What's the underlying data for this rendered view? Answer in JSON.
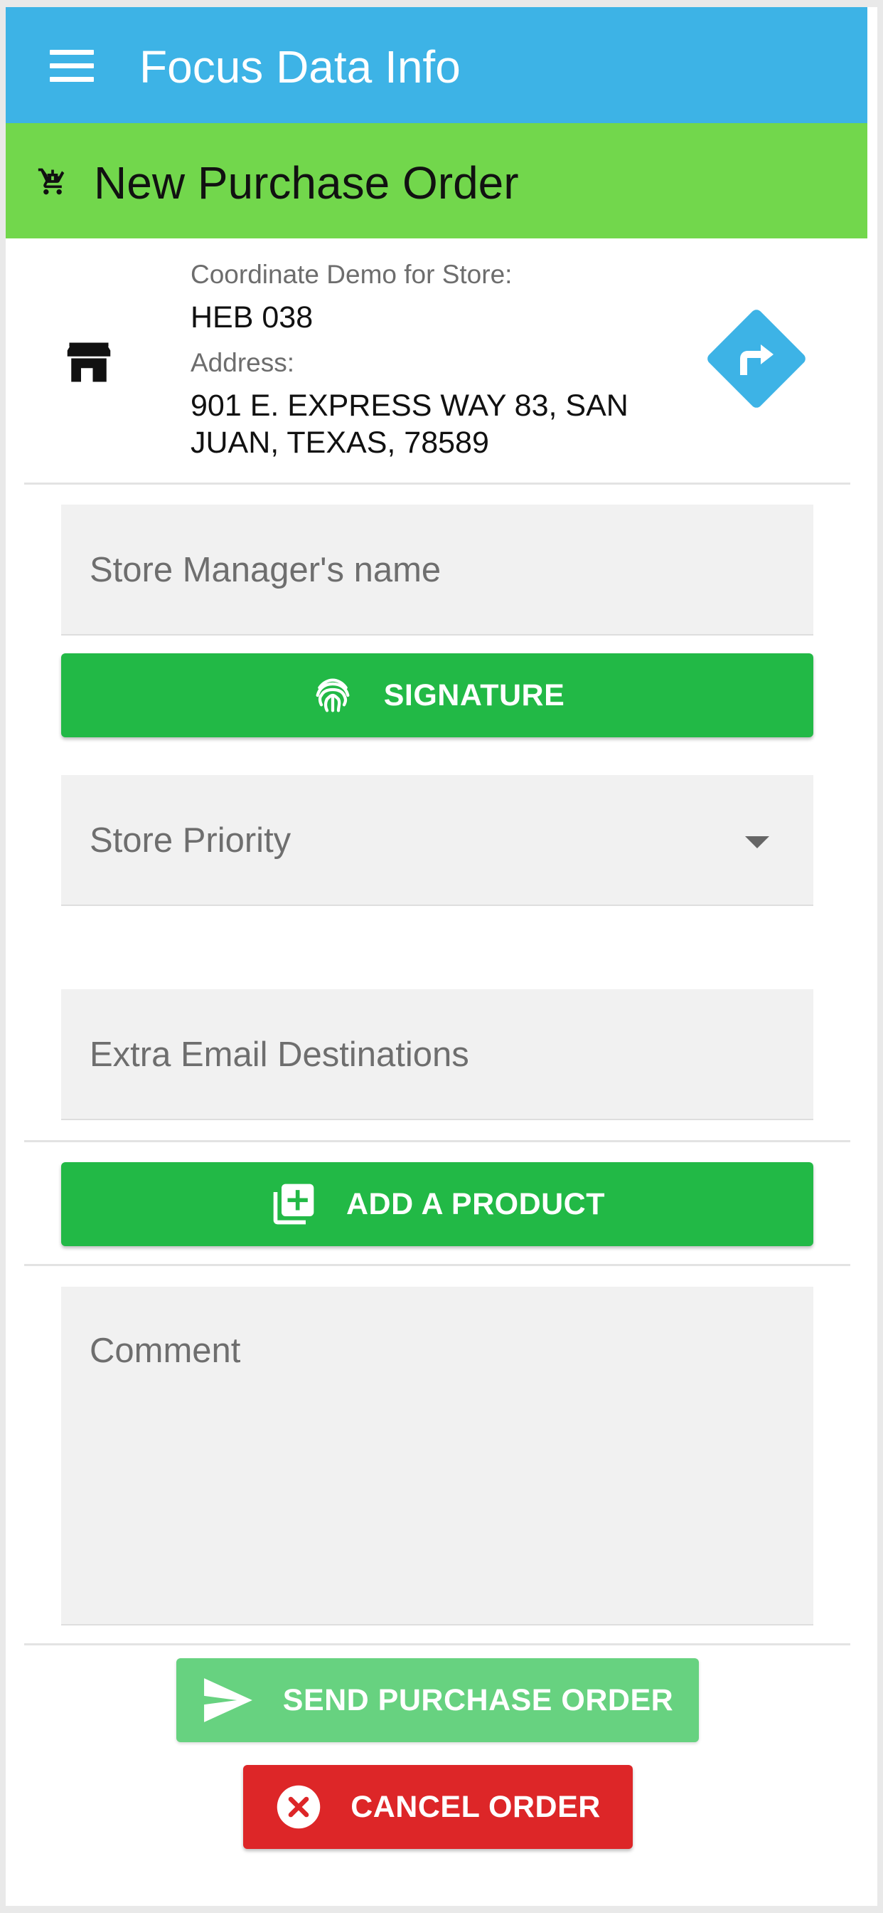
{
  "app_bar": {
    "title": "Focus Data Info",
    "menu_icon": "hamburger-menu-icon"
  },
  "page_header": {
    "title": "New Purchase Order",
    "icon": "cart-icon"
  },
  "store": {
    "icon": "store-icon",
    "store_label": "Coordinate Demo for Store:",
    "store_name": "HEB 038",
    "address_label": "Address:",
    "address_line1": "901 E. EXPRESS WAY 83, SAN",
    "address_line2": "JUAN, TEXAS, 78589",
    "navigate_icon": "directions-icon"
  },
  "form": {
    "manager_placeholder": "Store Manager's name",
    "manager_value": "",
    "signature_label": "SIGNATURE",
    "signature_icon": "fingerprint-icon",
    "priority_placeholder": "Store Priority",
    "priority_value": "",
    "email_placeholder": "Extra Email Destinations",
    "email_value": "",
    "add_product_label": "ADD A PRODUCT",
    "add_product_icon": "library-add-icon",
    "comment_placeholder": "Comment",
    "comment_value": ""
  },
  "actions": {
    "send_label": "SEND PURCHASE ORDER",
    "send_icon": "send-icon",
    "cancel_label": "CANCEL ORDER",
    "cancel_icon": "cancel-circle-icon"
  },
  "colors": {
    "app_bar": "#3db3e6",
    "page_header": "#72d74c",
    "primary_button": "#22b946",
    "send_button": "#67d280",
    "cancel_button": "#dd2628"
  }
}
